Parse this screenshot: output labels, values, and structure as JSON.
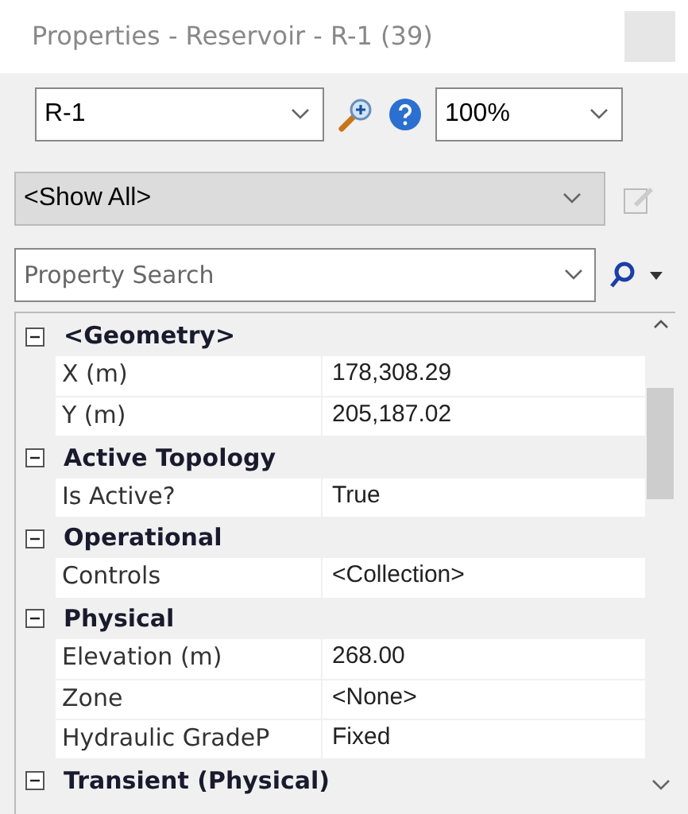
{
  "window": {
    "title": "Properties - Reservoir - R-1 (39)"
  },
  "toolbar": {
    "element": {
      "value": "R-1"
    },
    "zoom": {
      "value": "100%"
    }
  },
  "filter": {
    "value": "<Show All>"
  },
  "search": {
    "placeholder": "Property Search"
  },
  "grid": {
    "categories": [
      {
        "name": "<Geometry>",
        "expanded": true,
        "properties": [
          {
            "name": "X (m)",
            "value": "178,308.29"
          },
          {
            "name": "Y (m)",
            "value": "205,187.02"
          }
        ]
      },
      {
        "name": "Active Topology",
        "expanded": true,
        "properties": [
          {
            "name": "Is Active?",
            "value": "True"
          }
        ]
      },
      {
        "name": "Operational",
        "expanded": true,
        "properties": [
          {
            "name": "Controls",
            "value": "<Collection>"
          }
        ]
      },
      {
        "name": "Physical",
        "expanded": true,
        "properties": [
          {
            "name": "Elevation (m)",
            "value": "268.00"
          },
          {
            "name": "Zone",
            "value": "<None>"
          },
          {
            "name": "Hydraulic GradeP",
            "value": "Fixed"
          }
        ]
      },
      {
        "name": "Transient (Physical)",
        "expanded": true
      }
    ]
  }
}
